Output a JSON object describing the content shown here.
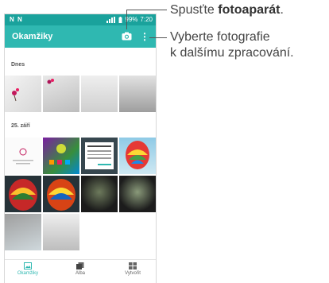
{
  "status_bar": {
    "left_icons": "N N",
    "battery": "99%",
    "time": "7:20"
  },
  "app_bar": {
    "title": "Okamžiky"
  },
  "sections": [
    {
      "label": "Dnes"
    },
    {
      "label": "25. září"
    }
  ],
  "bottom_nav": [
    {
      "label": "Okamžiky",
      "icon": "photo-icon",
      "active": true
    },
    {
      "label": "Alba",
      "icon": "albums-icon",
      "active": false
    },
    {
      "label": "Vytvořit",
      "icon": "create-icon",
      "active": false
    }
  ],
  "callouts": {
    "camera_prefix": "Spusťte ",
    "camera_bold": "fotoaparát",
    "camera_suffix": ".",
    "more_line1": "Vyberte fotografie",
    "more_line2": "k dalšímu zpracování."
  },
  "colors": {
    "status_bar": "#1aa29c",
    "app_bar": "#2fb8b1",
    "accent": "#2fb8b1"
  }
}
